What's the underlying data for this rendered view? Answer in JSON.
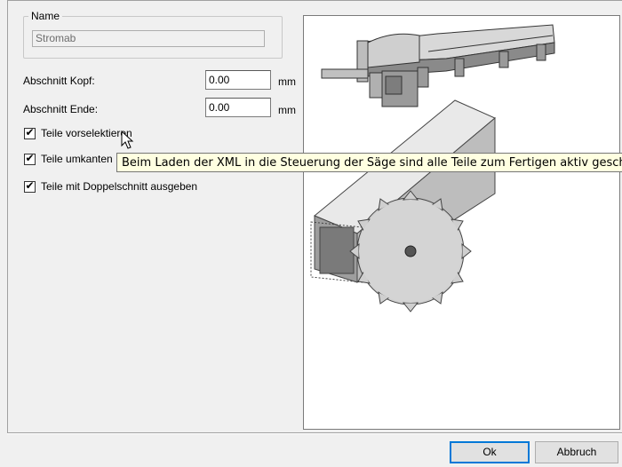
{
  "name_group": {
    "legend": "Name",
    "value": "Stromab"
  },
  "fields": [
    {
      "label": "Abschnitt Kopf:",
      "value": "0.00",
      "unit": "mm"
    },
    {
      "label": "Abschnitt Ende:",
      "value": "0.00",
      "unit": "mm"
    }
  ],
  "checkboxes": [
    {
      "label": "Teile vorselektieren",
      "checked": true
    },
    {
      "label": "Teile umkanten",
      "checked": true
    },
    {
      "label": "Teile mit Doppelschnitt ausgeben",
      "checked": true
    }
  ],
  "tooltip": "Beim Laden der XML in die Steuerung der Säge sind alle Teile zum Fertigen aktiv geschaltet",
  "buttons": {
    "ok": "Ok",
    "cancel": "Abbruch"
  },
  "icons": {
    "check": "checkmark-icon",
    "cursor": "mouse-pointer-icon"
  }
}
